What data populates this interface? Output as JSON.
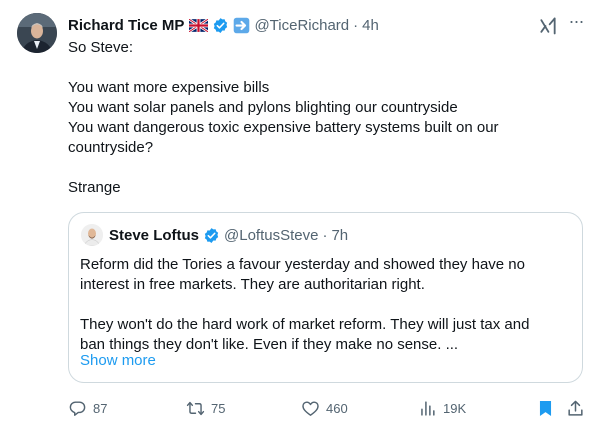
{
  "author": {
    "name": "Richard Tice MP",
    "handle": "@TiceRichard",
    "separator": "·",
    "time": "4h"
  },
  "tweet": {
    "lines": [
      "So Steve:",
      "",
      "You want more expensive bills",
      "You want solar panels and pylons blighting our countryside",
      "You want dangerous toxic expensive battery systems built on our",
      "countryside?",
      "",
      "Strange"
    ]
  },
  "quoted": {
    "name": "Steve Loftus",
    "handle": "@LoftusSteve",
    "separator": "·",
    "time": "7h",
    "lines": [
      "Reform did the Tories a favour yesterday and showed they have no",
      "interest in free markets. They are authoritarian right.",
      "",
      "They won't do the hard work of market reform. They will just tax and",
      "ban things they don't like. Even if they make no sense. ..."
    ],
    "show_more": "Show more"
  },
  "actions": {
    "replies": "87",
    "reposts": "75",
    "likes": "460",
    "views": "19K"
  },
  "menu_glyph": "···",
  "colors": {
    "text": "#0f1419",
    "secondary": "#536471",
    "link": "#1d9bf0",
    "verified": "#1d9bf0",
    "bookmark": "#1d9bf0",
    "border": "#cfd9de"
  }
}
